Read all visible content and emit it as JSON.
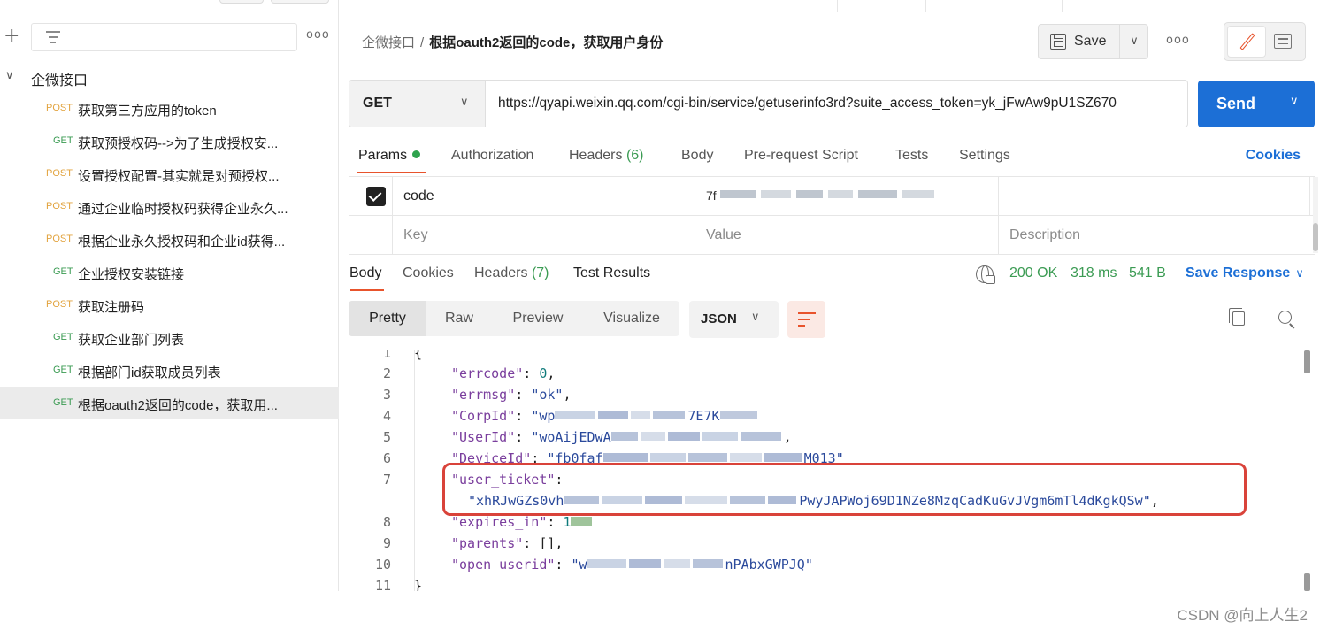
{
  "sidebar": {
    "collection_name": "企微接口",
    "requests": [
      {
        "method": "POST",
        "name": "获取第三方应用的token"
      },
      {
        "method": "GET",
        "name": "获取预授权码-->为了生成授权安..."
      },
      {
        "method": "POST",
        "name": "设置授权配置-其实就是对预授权..."
      },
      {
        "method": "POST",
        "name": "通过企业临时授权码获得企业永久..."
      },
      {
        "method": "POST",
        "name": "根据企业永久授权码和企业id获得..."
      },
      {
        "method": "GET",
        "name": "企业授权安装链接"
      },
      {
        "method": "POST",
        "name": "获取注册码"
      },
      {
        "method": "GET",
        "name": "获取企业部门列表"
      },
      {
        "method": "GET",
        "name": "根据部门id获取成员列表"
      },
      {
        "method": "GET",
        "name": "根据oauth2返回的code，获取用..."
      }
    ]
  },
  "header": {
    "breadcrumb_collection": "企微接口",
    "breadcrumb_separator": "/",
    "request_title": "根据oauth2返回的code，获取用户身份",
    "save_label": "Save"
  },
  "request": {
    "method": "GET",
    "url": "https://qyapi.weixin.qq.com/cgi-bin/service/getuserinfo3rd?suite_access_token=yk_jFwAw9pU1SZ670",
    "send_label": "Send"
  },
  "request_tabs": {
    "params": "Params",
    "authorization": "Authorization",
    "headers": "Headers",
    "headers_count": "(6)",
    "body": "Body",
    "prerequest": "Pre-request Script",
    "tests": "Tests",
    "settings": "Settings",
    "cookies": "Cookies"
  },
  "params": {
    "row_key": "code",
    "row_value_prefix": "7f",
    "key_placeholder": "Key",
    "value_placeholder": "Value",
    "description_placeholder": "Description"
  },
  "response_tabs": {
    "body": "Body",
    "cookies": "Cookies",
    "headers": "Headers",
    "headers_count": "(7)",
    "test_results": "Test Results",
    "status": "200 OK",
    "time": "318 ms",
    "size": "541 B",
    "save_response": "Save Response"
  },
  "view_modes": {
    "pretty": "Pretty",
    "raw": "Raw",
    "preview": "Preview",
    "visualize": "Visualize",
    "format": "JSON"
  },
  "code_lines": [
    {
      "n": "1",
      "text": "{"
    },
    {
      "n": "2",
      "key": "\"errcode\"",
      "value": "0",
      "type": "num"
    },
    {
      "n": "3",
      "key": "\"errmsg\"",
      "value": "\"ok\"",
      "type": "str"
    },
    {
      "n": "4",
      "key": "\"CorpId\"",
      "value_start": "\"wp",
      "value_end": "7E7K"
    },
    {
      "n": "5",
      "key": "\"UserId\"",
      "value_start": "\"woAijEDwA"
    },
    {
      "n": "6",
      "key": "\"DeviceId\"",
      "value_start": "\"fb0faf",
      "value_end": "M013\""
    },
    {
      "n": "7",
      "key": "\"user_ticket\"",
      "value_start": "\"xhRJwGZs0vh",
      "value_end": "PwyJAPWoj69D1NZe8MzqCadKuGvJVgm6mTl4dKgkQSw\""
    },
    {
      "n": "8",
      "key": "\"expires_in\"",
      "value_start": "1"
    },
    {
      "n": "9",
      "key": "\"parents\"",
      "value": "[]",
      "type": "pun"
    },
    {
      "n": "10",
      "key": "\"open_userid\"",
      "value_start": "\"w",
      "value_end": "nPAbxGWPJQ\""
    },
    {
      "n": "11",
      "text": "}"
    }
  ],
  "watermark": "CSDN @向上人生2",
  "colors": {
    "accent": "#e8532c",
    "send": "#1c6fd6",
    "status_ok": "#3b9b53",
    "post": "#e2a33e",
    "get": "#3b9b53",
    "highlight": "#d9433a"
  }
}
